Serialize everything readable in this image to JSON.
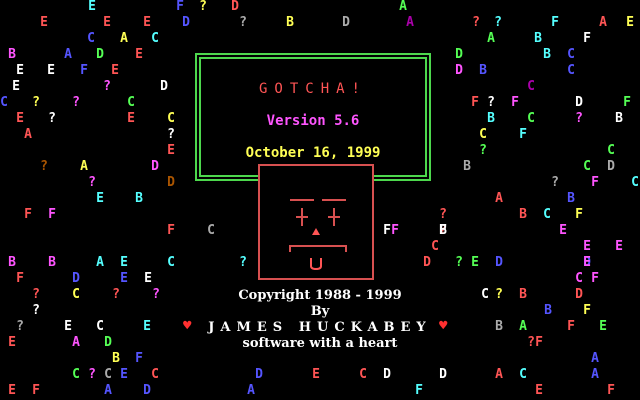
{
  "splash": {
    "title": "GOTCHA!",
    "version": "Version 5.6",
    "date": "October 16, 1999",
    "copyright": "Copyright 1988 - 1999",
    "by": "By",
    "author": "JAMES HUCKABEY",
    "tagline": "software with a heart"
  },
  "colors": {
    "background": "#000000",
    "title": "#ff5555",
    "version": "#ff55ff",
    "date": "#ffff55",
    "frame": "#4dd84d",
    "face": "#d75050",
    "credits": "#ffffff",
    "heart": "#ff3030"
  },
  "icons": {
    "face": "robot-face-icon",
    "heart": "heart-icon"
  },
  "background_letters": [
    [
      "E",
      "#55ffff"
    ],
    [
      "F",
      "#5555ff"
    ],
    [
      "?",
      "#ffff55"
    ],
    [
      "D",
      "#ff5555"
    ],
    [
      "A",
      "#55ff55"
    ],
    [
      "E",
      "#ff5555"
    ],
    [
      "E",
      "#ff5555"
    ],
    [
      "E",
      "#ff5555"
    ],
    [
      "D",
      "#5555ff"
    ],
    [
      "?",
      "#aaaaaa"
    ],
    [
      "B",
      "#ffff55"
    ],
    [
      "D",
      "#aaaaaa"
    ],
    [
      "A",
      "#aa00aa"
    ],
    [
      "?",
      "#ff5555"
    ],
    [
      "?",
      "#55ffff"
    ],
    [
      "F",
      "#55ffff"
    ],
    [
      "A",
      "#ff5555"
    ],
    [
      "E",
      "#ffff55"
    ],
    [
      "C",
      "#5555ff"
    ],
    [
      "A",
      "#ffff55"
    ],
    [
      "C",
      "#55ffff"
    ],
    [
      "A",
      "#55ff55"
    ],
    [
      "B",
      "#55ffff"
    ],
    [
      "F",
      "#ffffff"
    ],
    [
      "B",
      "#ff55ff"
    ],
    [
      "A",
      "#5555ff"
    ],
    [
      "D",
      "#55ff55"
    ],
    [
      "E",
      "#ff5555"
    ],
    [
      "D",
      "#55ff55"
    ],
    [
      "B",
      "#55ffff"
    ],
    [
      "C",
      "#5555ff"
    ],
    [
      "E",
      "#ffffff"
    ],
    [
      "E",
      "#ffffff"
    ],
    [
      "F",
      "#5555ff"
    ],
    [
      "E",
      "#ff5555"
    ],
    [
      "D",
      "#ff55ff"
    ],
    [
      "B",
      "#5555ff"
    ],
    [
      "C",
      "#5555ff"
    ],
    [
      "E",
      "#ffffff"
    ],
    [
      "?",
      "#ff55ff"
    ],
    [
      "D",
      "#ffffff"
    ],
    [
      "C",
      "#aa00aa"
    ],
    [
      "C",
      "#5555ff"
    ],
    [
      "?",
      "#ffff55"
    ],
    [
      "?",
      "#ff55ff"
    ],
    [
      "C",
      "#55ff55"
    ],
    [
      "F",
      "#ff5555"
    ],
    [
      "?",
      "#ffffff"
    ],
    [
      "F",
      "#ff55ff"
    ],
    [
      "D",
      "#ffffff"
    ],
    [
      "F",
      "#55ff55"
    ],
    [
      "E",
      "#ff5555"
    ],
    [
      "?",
      "#ffffff"
    ],
    [
      "E",
      "#ff5555"
    ],
    [
      "C",
      "#ffff55"
    ],
    [
      "B",
      "#55ffff"
    ],
    [
      "C",
      "#55ff55"
    ],
    [
      "?",
      "#ff55ff"
    ],
    [
      "B",
      "#ffffff"
    ],
    [
      "A",
      "#ff5555"
    ],
    [
      "?",
      "#ffffff"
    ],
    [
      "C",
      "#ffff55"
    ],
    [
      "F",
      "#55ffff"
    ],
    [
      "E",
      "#ff5555"
    ],
    [
      "?",
      "#55ff55"
    ],
    [
      "C",
      "#55ff55"
    ],
    [
      "?",
      "#aa5500"
    ],
    [
      "A",
      "#ffff55"
    ],
    [
      "D",
      "#ff55ff"
    ],
    [
      "B",
      "#aaaaaa"
    ],
    [
      "C",
      "#55ff55"
    ],
    [
      "D",
      "#aaaaaa"
    ],
    [
      "?",
      "#ff55ff"
    ],
    [
      "D",
      "#aa5500"
    ],
    [
      "?",
      "#aaaaaa"
    ],
    [
      "F",
      "#ff55ff"
    ],
    [
      "C",
      "#55ffff"
    ],
    [
      "E",
      "#55ffff"
    ],
    [
      "B",
      "#55ffff"
    ],
    [
      "A",
      "#ff5555"
    ],
    [
      "B",
      "#5555ff"
    ],
    [
      "F",
      "#ff5555"
    ],
    [
      "F",
      "#ff55ff"
    ],
    [
      "?",
      "#ff5555"
    ],
    [
      "B",
      "#ff5555"
    ],
    [
      "C",
      "#55ffff"
    ],
    [
      "F",
      "#ffff55"
    ],
    [
      "F",
      "#ff5555"
    ],
    [
      "C",
      "#aaaaaa"
    ],
    [
      "F",
      "#ffffff"
    ],
    [
      "?",
      "#ff5555"
    ],
    [
      "F",
      "#ffffff"
    ],
    [
      "B",
      "#ffffff"
    ],
    [
      "E",
      "#ff55ff"
    ],
    [
      "F",
      "#ff55ff"
    ],
    [
      "C",
      "#ff5555"
    ],
    [
      "E",
      "#ff55ff"
    ],
    [
      "E",
      "#ff55ff"
    ],
    [
      "B",
      "#ff55ff"
    ],
    [
      "B",
      "#ff55ff"
    ],
    [
      "A",
      "#55ffff"
    ],
    [
      "E",
      "#55ffff"
    ],
    [
      "C",
      "#55ffff"
    ],
    [
      "?",
      "#55ffff"
    ],
    [
      "D",
      "#ff5555"
    ],
    [
      "?",
      "#55ff55"
    ],
    [
      "E",
      "#55ff55"
    ],
    [
      "D",
      "#5555ff"
    ],
    [
      "D",
      "#5555ff"
    ],
    [
      "E",
      "#ff55ff"
    ],
    [
      "F",
      "#ff5555"
    ],
    [
      "D",
      "#5555ff"
    ],
    [
      "E",
      "#5555ff"
    ],
    [
      "E",
      "#ffffff"
    ],
    [
      "C",
      "#ff55ff"
    ],
    [
      "F",
      "#ff55ff"
    ],
    [
      "?",
      "#ff5555"
    ],
    [
      "C",
      "#ffff55"
    ],
    [
      "?",
      "#ff5555"
    ],
    [
      "?",
      "#ff55ff"
    ],
    [
      "C",
      "#ffffff"
    ],
    [
      "?",
      "#ffff55"
    ],
    [
      "B",
      "#ff5555"
    ],
    [
      "D",
      "#ff5555"
    ],
    [
      "?",
      "#ffffff"
    ],
    [
      "B",
      "#5555ff"
    ],
    [
      "F",
      "#ffff55"
    ],
    [
      "?",
      "#aaaaaa"
    ],
    [
      "E",
      "#ffffff"
    ],
    [
      "C",
      "#ffffff"
    ],
    [
      "E",
      "#55ffff"
    ],
    [
      "B",
      "#aaaaaa"
    ],
    [
      "A",
      "#55ff55"
    ],
    [
      "F",
      "#ff5555"
    ],
    [
      "E",
      "#55ff55"
    ],
    [
      "E",
      "#ff5555"
    ],
    [
      "A",
      "#ff55ff"
    ],
    [
      "D",
      "#55ff55"
    ],
    [
      "?",
      "#ff5555"
    ],
    [
      "F",
      "#ff5555"
    ],
    [
      "B",
      "#ffff55"
    ],
    [
      "F",
      "#5555ff"
    ],
    [
      "A",
      "#5555ff"
    ],
    [
      "C",
      "#55ff55"
    ],
    [
      "?",
      "#ff55ff"
    ],
    [
      "C",
      "#aaaaaa"
    ],
    [
      "E",
      "#5555ff"
    ],
    [
      "C",
      "#ff5555"
    ],
    [
      "A",
      "#ff5555"
    ],
    [
      "C",
      "#55ffff"
    ],
    [
      "E",
      "#ff5555"
    ],
    [
      "F",
      "#ff5555"
    ],
    [
      "A",
      "#5555ff"
    ],
    [
      "D",
      "#5555ff"
    ],
    [
      "A",
      "#5555ff"
    ],
    [
      "D",
      "#5555ff"
    ],
    [
      "E",
      "#ff5555"
    ],
    [
      "C",
      "#ff5555"
    ],
    [
      "D",
      "#ffffff"
    ],
    [
      "F",
      "#55ffff"
    ],
    [
      "E",
      "#ff5555"
    ],
    [
      "F",
      "#ff5555"
    ],
    [
      "D",
      "#ffffff"
    ],
    [
      "A",
      "#5555ff"
    ]
  ]
}
